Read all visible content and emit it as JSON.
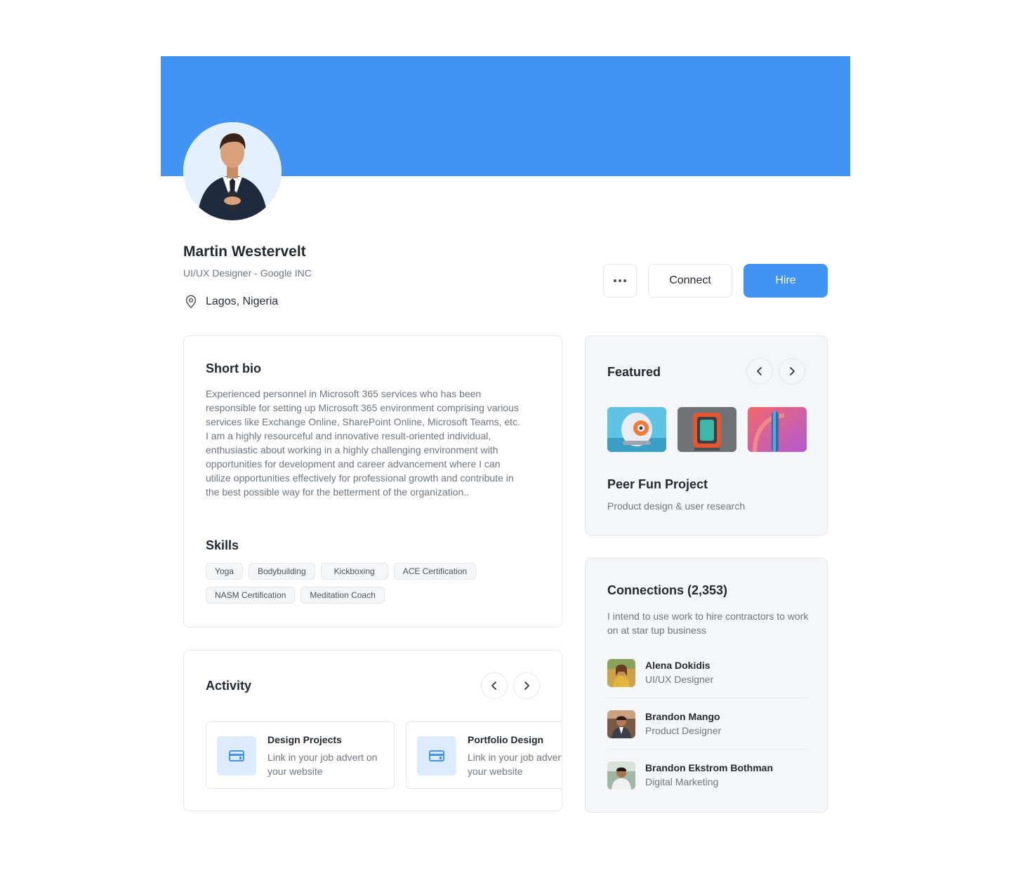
{
  "profile": {
    "name": "Martin Westervelt",
    "role": "UI/UX Designer - Google INC",
    "location": "Lagos, Nigeria"
  },
  "actions": {
    "more_icon": "more-horizontal-icon",
    "connect_label": "Connect",
    "hire_label": "Hire"
  },
  "bio": {
    "title": "Short bio",
    "text": "Experienced personnel in Microsoft 365 services who has been responsible for setting up Microsoft 365 environment comprising various services like Exchange Online, SharePoint Online, Microsoft Teams, etc. I am a highly resourceful and innovative result-oriented individual, enthusiastic about working in a highly challenging environment with opportunities for development and career advancement where I can utilize opportunities effectively for professional growth and contribute in the best possible way for the betterment of the organization.."
  },
  "skills": {
    "title": "Skills",
    "items": [
      "Yoga",
      "Bodybuilding",
      "Kickboxing",
      "ACE Certification",
      "NASM Certification",
      "Meditation Coach"
    ]
  },
  "activity": {
    "title": "Activity",
    "items": [
      {
        "title": "Design Projects",
        "desc": "Link in your job advert on your website"
      },
      {
        "title": "Portfolio Design",
        "desc": "Link in your job advert on your website"
      }
    ]
  },
  "featured": {
    "title": "Featured",
    "project_title": "Peer Fun Project",
    "project_sub": "Product design & user research"
  },
  "connections": {
    "title": "Connections (2,353)",
    "desc": "I intend to use work to hire contractors to work on at star tup business",
    "people": [
      {
        "name": "Alena Dokidis",
        "role": "UI/UX Designer"
      },
      {
        "name": "Brandon Mango",
        "role": "Product Designer"
      },
      {
        "name": "Brandon Ekstrom Bothman",
        "role": "Digital Marketing"
      }
    ]
  },
  "colors": {
    "accent": "#4193f4",
    "card_grey": "#f5f6f8",
    "muted_text": "#6f767e"
  }
}
